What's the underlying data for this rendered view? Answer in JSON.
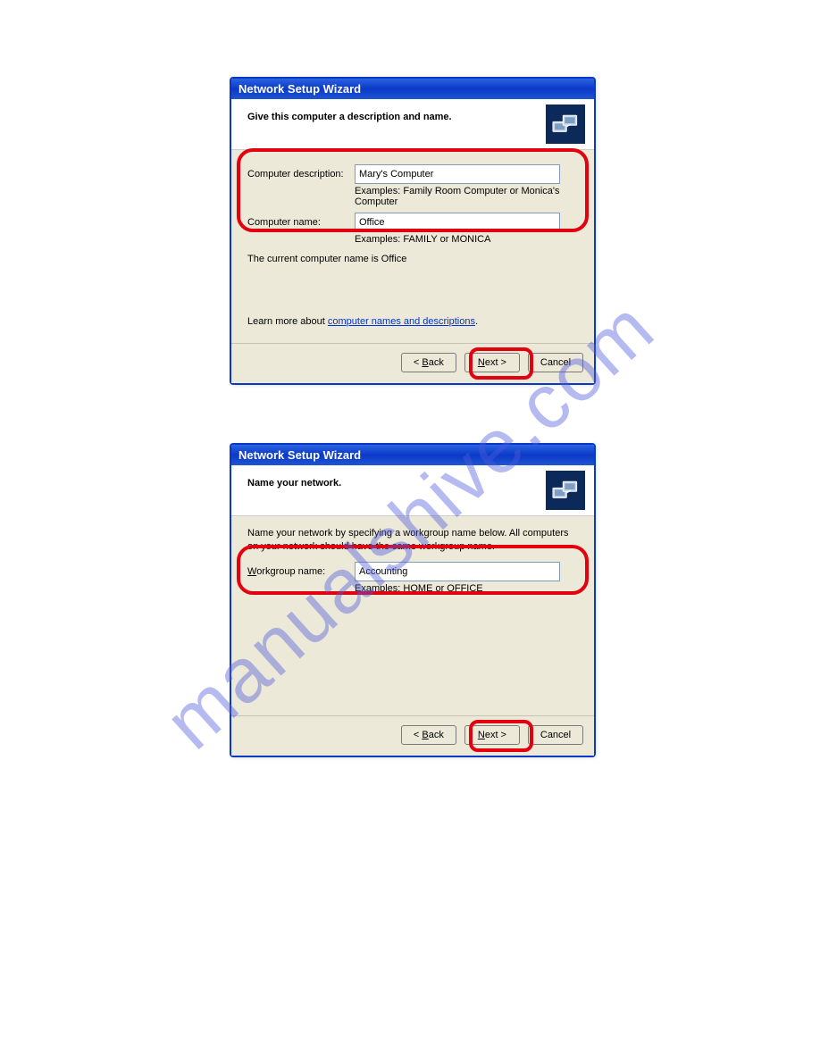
{
  "watermark": "manualshive.com",
  "dialog1": {
    "title": "Network Setup Wizard",
    "header": "Give this computer a description and name.",
    "desc_label": "Computer description:",
    "desc_value": "Mary's Computer",
    "desc_hint": "Examples: Family Room Computer or Monica's Computer",
    "name_label": "Computer name:",
    "name_value": "Office",
    "name_hint": "Examples: FAMILY or MONICA",
    "current_prefix": "The current computer name is ",
    "current_value": "Office",
    "learn_prefix": "Learn more about ",
    "learn_link": "computer names and descriptions",
    "back": "< Back",
    "next": "Next >",
    "cancel": "Cancel"
  },
  "dialog2": {
    "title": "Network Setup Wizard",
    "header": "Name your network.",
    "intro": "Name your network by specifying a workgroup name below. All computers on your network should have the same workgroup name.",
    "wg_label": "Workgroup name:",
    "wg_value": "Accounting",
    "wg_hint": "Examples: HOME or OFFICE",
    "back": "< Back",
    "next": "Next >",
    "cancel": "Cancel"
  }
}
